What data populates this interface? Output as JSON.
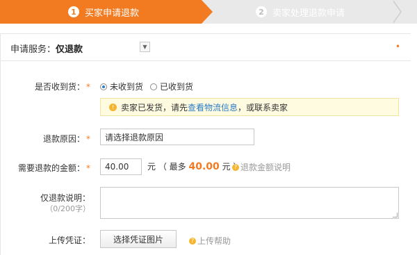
{
  "steps": [
    {
      "num": "1",
      "label": "买家申请退款"
    },
    {
      "num": "2",
      "label": "卖家处理退款申请"
    }
  ],
  "service": {
    "label": "申请服务：",
    "value": "仅退款",
    "required_mark": "•"
  },
  "received": {
    "label": "是否收到货：",
    "options": [
      {
        "label": "未收到货",
        "selected": true
      },
      {
        "label": "已收到货",
        "selected": false
      }
    ]
  },
  "notice": {
    "prefix": "卖家已发货，请先 ",
    "link": "查看物流信息",
    "suffix": "，或联系卖家"
  },
  "reason": {
    "label": "退款原因：",
    "placeholder": "请选择退款原因"
  },
  "amount": {
    "label": "需要退款的金额：",
    "value": "40.00",
    "unit": "元",
    "max_prefix": "（ 最多 ",
    "max_value": "40.00",
    "max_suffix": " 元 ）",
    "help": "退款金额说明"
  },
  "description": {
    "label": "仅退款说明：",
    "counter": "（0/200字）"
  },
  "upload": {
    "label": "上传凭证：",
    "button": "选择凭证图片",
    "help": "上传帮助"
  },
  "colors": {
    "accent": "#f27b21",
    "link": "#2a7cc7"
  }
}
